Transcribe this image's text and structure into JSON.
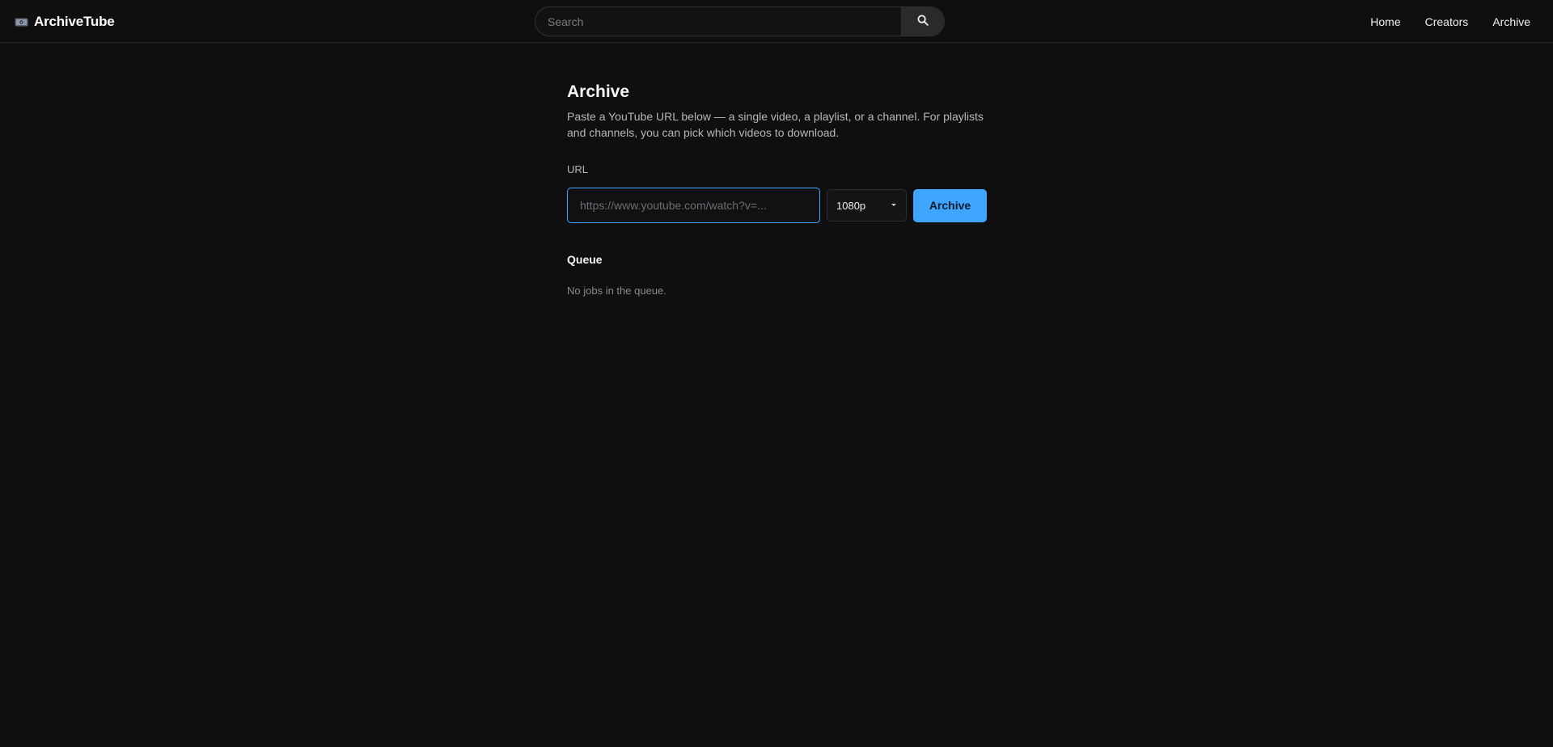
{
  "app": {
    "name": "ArchiveTube",
    "logo_icon": "film-reel-icon"
  },
  "search": {
    "placeholder": "Search",
    "value": "",
    "button_icon": "search-icon"
  },
  "nav": {
    "items": [
      {
        "label": "Home"
      },
      {
        "label": "Creators"
      },
      {
        "label": "Archive"
      }
    ]
  },
  "main": {
    "title": "Archive",
    "description": "Paste a YouTube URL below — a single video, a playlist, or a channel. For playlists and channels, you can pick which videos to download.",
    "url_label": "URL",
    "url_input": {
      "placeholder": "https://www.youtube.com/watch?v=...",
      "value": ""
    },
    "quality_select": {
      "selected": "1080p"
    },
    "archive_button": "Archive",
    "queue_title": "Queue",
    "queue_empty": "No jobs in the queue."
  },
  "colors": {
    "background": "#0f0f10",
    "accent": "#3ea6ff",
    "text": "#f1f1f1",
    "muted": "#b7b7bb",
    "border": "#2a2a2d"
  }
}
